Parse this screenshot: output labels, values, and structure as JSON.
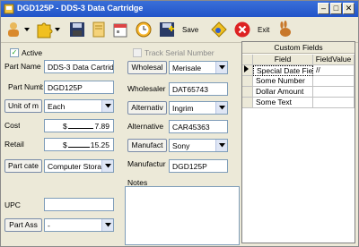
{
  "window": {
    "title": "DGD125P - DDS-3 Data Cartridge"
  },
  "toolbar": {
    "save_label": "Save",
    "exit_label": "Exit"
  },
  "form": {
    "active_label": "Active",
    "track_serial_label": "Track Serial Number",
    "part_name": {
      "label": "Part Name",
      "value": "DDS-3 Data Cartridg"
    },
    "part_number": {
      "label": "Part Numb",
      "value": "DGD125P"
    },
    "unit_of_measure": {
      "label": "Unit of m",
      "value": "Each"
    },
    "cost": {
      "label": "Cost",
      "currency": "$",
      "value": "7.89"
    },
    "retail": {
      "label": "Retail",
      "currency": "$",
      "value": "15.25"
    },
    "part_category": {
      "label": "Part cate",
      "value": "Computer Storag"
    },
    "upc": {
      "label": "UPC",
      "value": ""
    },
    "part_assembly": {
      "label": "Part Ass",
      "value": "-"
    },
    "wholesaler": {
      "button_label": "Wholesal",
      "value": "Merisale"
    },
    "wholesaler_code": {
      "label": "Wholesaler",
      "value": "DAT65743"
    },
    "alternative": {
      "button_label": "Alternativ",
      "value": "Ingrim"
    },
    "alternative_code": {
      "label": "Alternative",
      "value": "CAR45363"
    },
    "manufacturer": {
      "button_label": "Manufact",
      "value": "Sony"
    },
    "manufacturer_code": {
      "label": "Manufactur",
      "value": "DGD125P"
    },
    "notes_label": "Notes"
  },
  "custom_fields": {
    "title": "Custom Fields",
    "columns": [
      "Field",
      "FieldValue"
    ],
    "rows": [
      {
        "field": "Special Date Fiel",
        "value": "//"
      },
      {
        "field": "Some Number",
        "value": ""
      },
      {
        "field": "Dollar Amount",
        "value": ""
      },
      {
        "field": "Some Text",
        "value": ""
      }
    ]
  },
  "colors": {
    "titlebar": "#2154c9",
    "window_bg": "#ece9d8",
    "field_border": "#7f9db9",
    "checkmark": "#21a121"
  }
}
